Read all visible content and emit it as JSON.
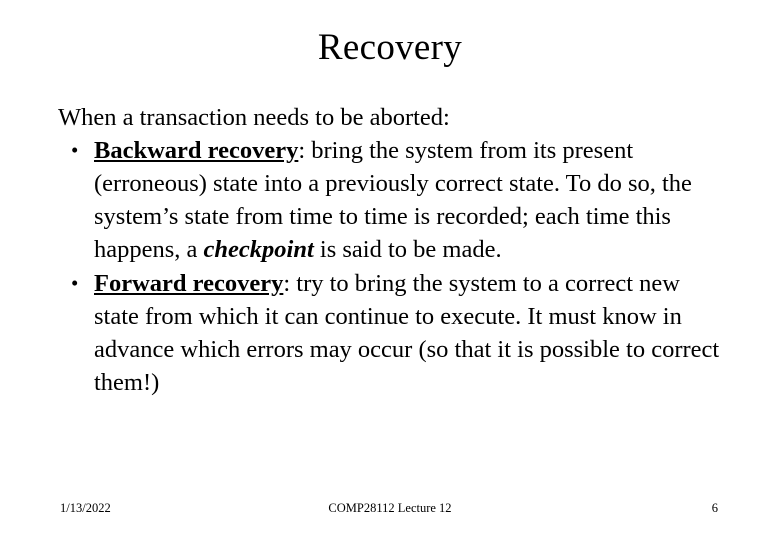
{
  "slide": {
    "title": "Recovery",
    "lead": "When a transaction needs to be aborted:",
    "bullets": [
      {
        "term": "Backward recovery",
        "rest_1": ": bring the system from its present (erroneous) state into a previously correct state. To do so, the system’s state from time to time is recorded; each time this happens, a ",
        "emph": "checkpoint",
        "rest_2": " is said to be made."
      },
      {
        "term": "Forward recovery",
        "rest_1": ": try to bring the system to a correct new state from which it can continue to execute. It must know in advance which errors may occur (so that it is possible to correct them!)",
        "emph": "",
        "rest_2": ""
      }
    ],
    "footer": {
      "date": "1/13/2022",
      "center": "COMP28112 Lecture 12",
      "page": "6"
    }
  }
}
